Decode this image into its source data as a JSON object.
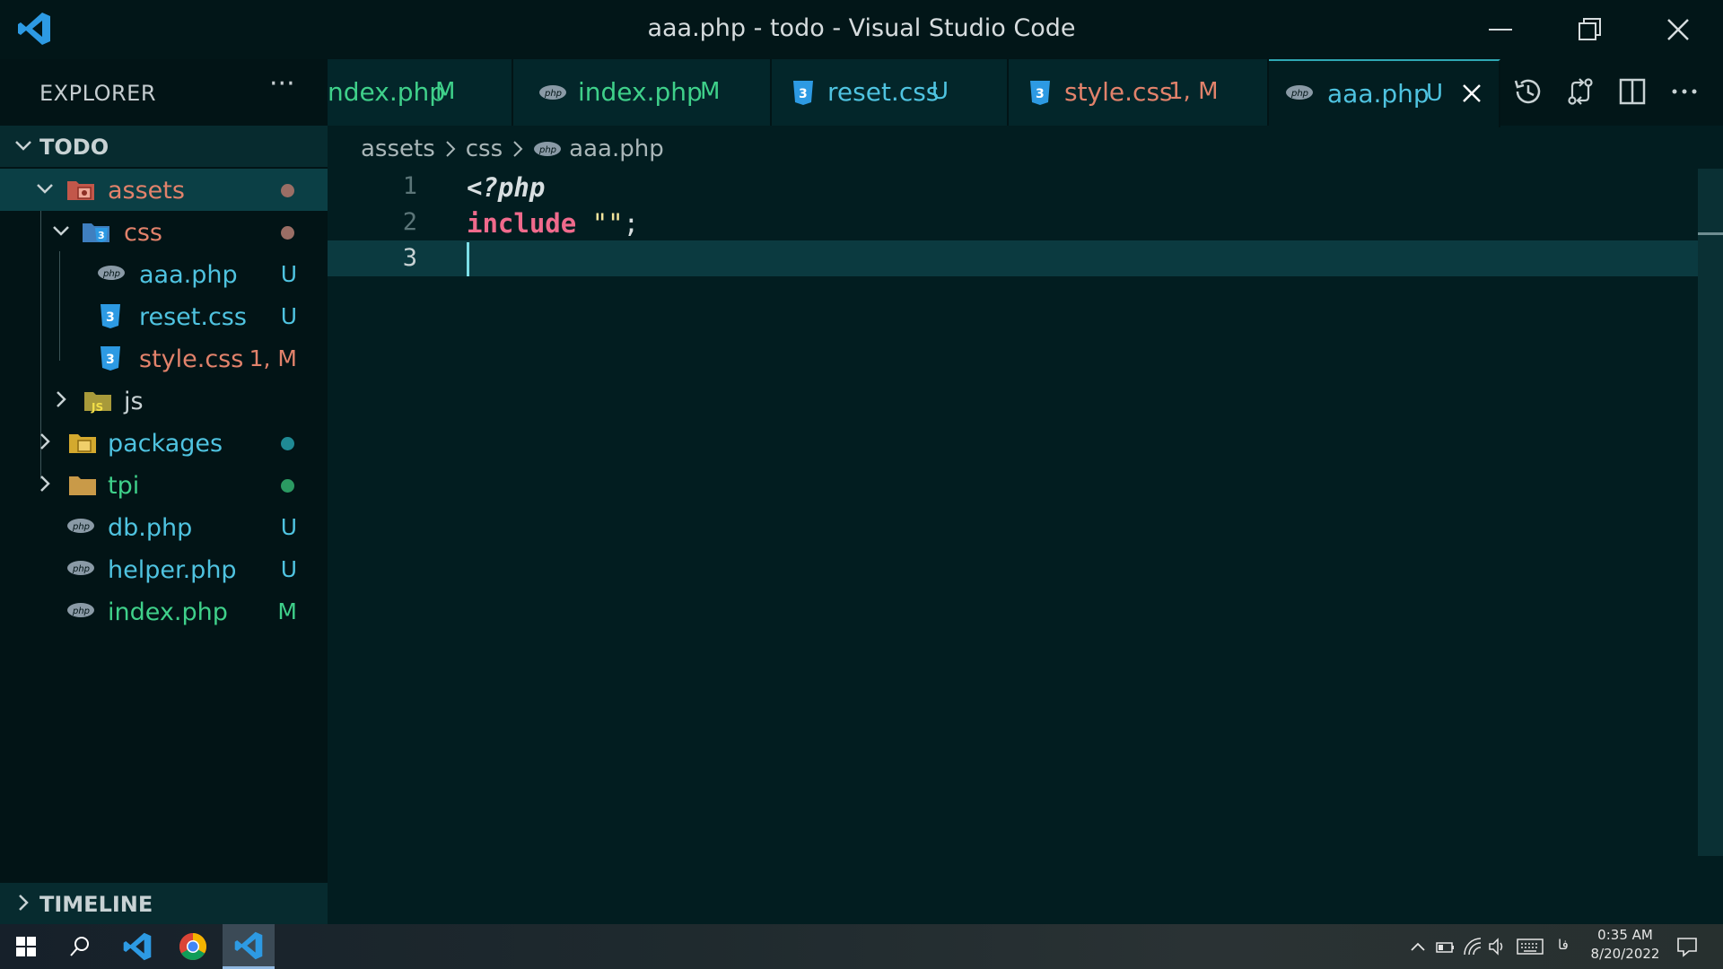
{
  "window": {
    "title": "aaa.php - todo - Visual Studio Code",
    "accent": "#2fa8b4"
  },
  "sidebar": {
    "header": "EXPLORER",
    "more": "···",
    "folder": "TODO",
    "timeline": "TIMELINE",
    "items": [
      {
        "name": "assets",
        "badge": "",
        "color": "#e2826b"
      },
      {
        "name": "css",
        "badge": "",
        "color": "#e2826b"
      },
      {
        "name": "aaa.php",
        "badge": "U",
        "color": "#4fc3e0"
      },
      {
        "name": "reset.css",
        "badge": "U",
        "color": "#4fc3e0"
      },
      {
        "name": "style.css",
        "badge": "1, M",
        "color": "#e2826b"
      },
      {
        "name": "js",
        "badge": "",
        "color": "#c8d2d4"
      },
      {
        "name": "packages",
        "badge": "",
        "color": "#4fc3e0"
      },
      {
        "name": "tpi",
        "badge": "",
        "color": "#3fd08a"
      },
      {
        "name": "db.php",
        "badge": "U",
        "color": "#4fc3e0"
      },
      {
        "name": "helper.php",
        "badge": "U",
        "color": "#4fc3e0"
      },
      {
        "name": "index.php",
        "badge": "M",
        "color": "#3fd08a"
      }
    ]
  },
  "tabs": [
    {
      "name": "ndex.php",
      "badge": "M"
    },
    {
      "name": "index.php",
      "badge": "M"
    },
    {
      "name": "reset.css",
      "badge": "U"
    },
    {
      "name": "style.css",
      "badge": "1, M"
    },
    {
      "name": "aaa.php",
      "badge": "U"
    }
  ],
  "breadcrumb": [
    "assets",
    "css",
    "aaa.php"
  ],
  "editor": {
    "line_numbers": [
      "1",
      "2",
      "3"
    ],
    "line1": "<?php",
    "line2_keyword": "include",
    "line2_string": "\"\"",
    "line2_end": ";"
  },
  "taskbar": {
    "lang": "فا",
    "time": "0:35 AM",
    "date": "8/20/2022"
  }
}
